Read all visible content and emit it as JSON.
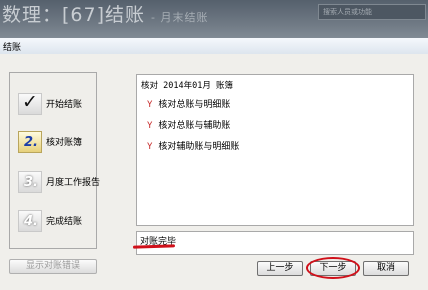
{
  "background_window": {
    "title": "数理：[67]结账",
    "subtitle": "- 月末结账",
    "search_placeholder": "搜索人员或功能"
  },
  "dialog": {
    "title": "结账",
    "steps": [
      {
        "number": "1.",
        "label": "开始结账",
        "state": "done",
        "icon": "check-icon"
      },
      {
        "number": "2.",
        "label": "核对账簿",
        "state": "current"
      },
      {
        "number": "3.",
        "label": "月度工作报告",
        "state": "pending"
      },
      {
        "number": "4.",
        "label": "完成结账",
        "state": "pending"
      }
    ],
    "result": {
      "heading": "核对 2014年01月 账簿",
      "items": [
        {
          "mark": "Y",
          "text": "核对总账与明细账"
        },
        {
          "mark": "Y",
          "text": "核对总账与辅助账"
        },
        {
          "mark": "Y",
          "text": "核对辅助账与明细账"
        }
      ]
    },
    "message": "对账完毕",
    "buttons": {
      "show_errors": "显示对账错误",
      "prev": "上一步",
      "next": "下一步",
      "cancel": "取消"
    }
  },
  "colors": {
    "mark_red": "#c62828",
    "annotation_red": "#d0101a"
  }
}
